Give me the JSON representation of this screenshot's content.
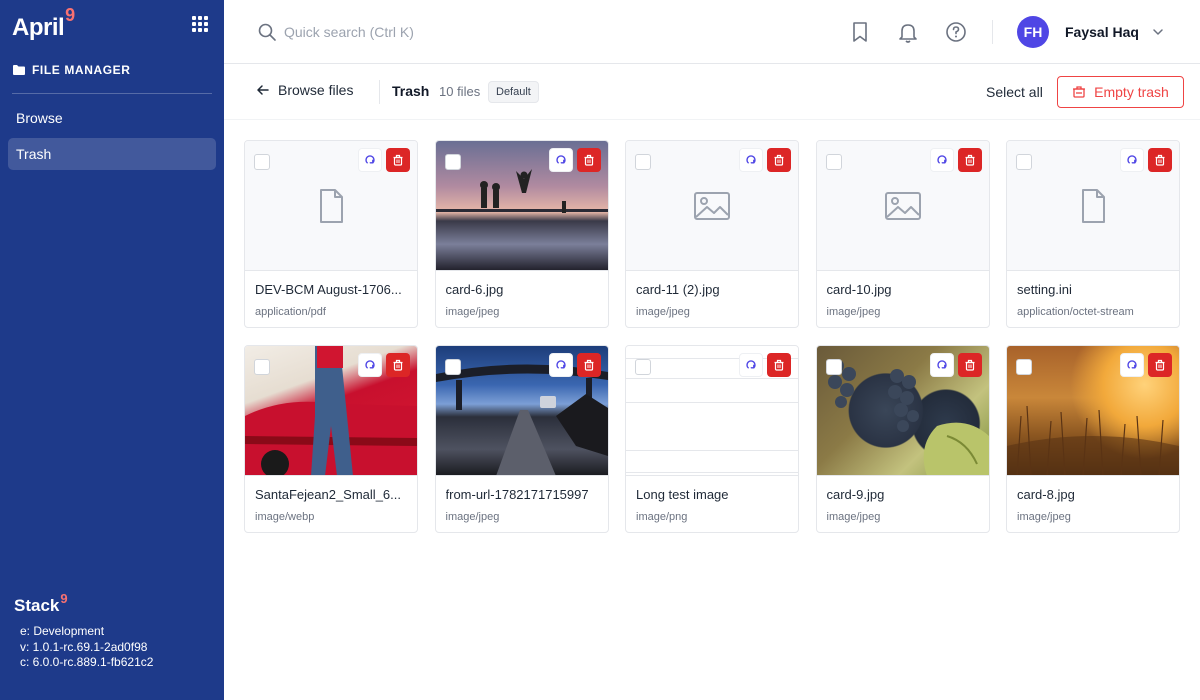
{
  "sidebar": {
    "brand": "April",
    "brand_sup": "9",
    "section_title": "FILE MANAGER",
    "items": [
      {
        "label": "Browse",
        "active": false
      },
      {
        "label": "Trash",
        "active": true
      }
    ],
    "footer": {
      "brand": "Stack",
      "brand_sup": "9",
      "env": "e: Development",
      "version": "v: 1.0.1-rc.69.1-2ad0f98",
      "core": "c: 6.0.0-rc.889.1-fb621c2"
    }
  },
  "header": {
    "search_placeholder": "Quick search (Ctrl K)",
    "user_initials": "FH",
    "user_name": "Faysal Haq"
  },
  "toolbar": {
    "back_label": "Browse files",
    "title": "Trash",
    "count": "10 files",
    "badge": "Default",
    "select_all": "Select all",
    "empty_trash": "Empty trash"
  },
  "files": [
    {
      "name": "DEV-BCM August-1706...",
      "type": "application/pdf",
      "thumb": "file"
    },
    {
      "name": "card-6.jpg",
      "type": "image/jpeg",
      "thumb": "sunset"
    },
    {
      "name": "card-11 (2).jpg",
      "type": "image/jpeg",
      "thumb": "image"
    },
    {
      "name": "card-10.jpg",
      "type": "image/jpeg",
      "thumb": "image"
    },
    {
      "name": "setting.ini",
      "type": "application/octet-stream",
      "thumb": "file"
    },
    {
      "name": "SantaFejean2_Small_6...",
      "type": "image/webp",
      "thumb": "red"
    },
    {
      "name": "from-url-1782171715997",
      "type": "image/jpeg",
      "thumb": "bridge"
    },
    {
      "name": "Long test image",
      "type": "image/png",
      "thumb": "long"
    },
    {
      "name": "card-9.jpg",
      "type": "image/jpeg",
      "thumb": "grapes"
    },
    {
      "name": "card-8.jpg",
      "type": "image/jpeg",
      "thumb": "field"
    }
  ],
  "colors": {
    "sidebar_bg": "#1e3a8a",
    "accent": "#4f46e5",
    "danger": "#dc2626",
    "brand_sup": "#f87171"
  }
}
